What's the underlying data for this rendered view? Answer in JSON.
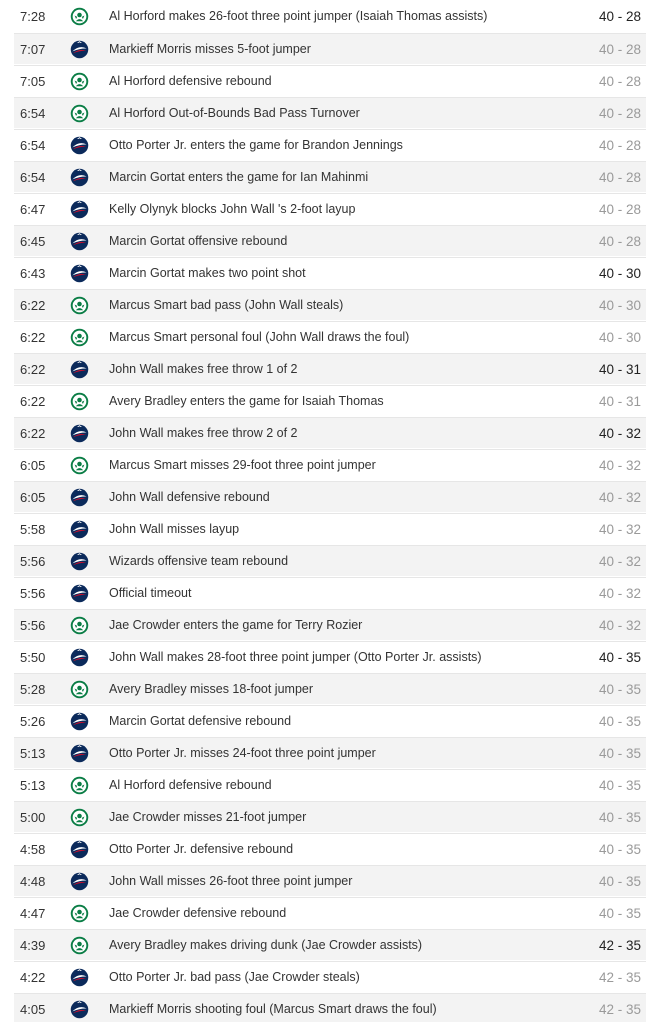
{
  "colors": {
    "celtics_green": "#0a7d45",
    "wizards_navy": "#0b2a5b",
    "wizards_red": "#c8102e",
    "score_unchanged": "#9a9a9a",
    "score_changed": "#222222"
  },
  "plays": [
    {
      "time": "7:28",
      "team": "BOS",
      "description": "Al Horford makes 26-foot three point jumper (Isaiah Thomas assists)",
      "score": "40 - 28",
      "score_changed": true
    },
    {
      "time": "7:07",
      "team": "WSH",
      "description": "Markieff Morris misses 5-foot jumper",
      "score": "40 - 28",
      "score_changed": false
    },
    {
      "time": "7:05",
      "team": "BOS",
      "description": "Al Horford defensive rebound",
      "score": "40 - 28",
      "score_changed": false
    },
    {
      "time": "6:54",
      "team": "BOS",
      "description": "Al Horford Out-of-Bounds Bad Pass Turnover",
      "score": "40 - 28",
      "score_changed": false
    },
    {
      "time": "6:54",
      "team": "WSH",
      "description": "Otto Porter Jr. enters the game for Brandon Jennings",
      "score": "40 - 28",
      "score_changed": false
    },
    {
      "time": "6:54",
      "team": "WSH",
      "description": "Marcin Gortat enters the game for Ian Mahinmi",
      "score": "40 - 28",
      "score_changed": false
    },
    {
      "time": "6:47",
      "team": "WSH",
      "description": "Kelly Olynyk blocks John Wall 's 2-foot layup",
      "score": "40 - 28",
      "score_changed": false
    },
    {
      "time": "6:45",
      "team": "WSH",
      "description": "Marcin Gortat offensive rebound",
      "score": "40 - 28",
      "score_changed": false
    },
    {
      "time": "6:43",
      "team": "WSH",
      "description": "Marcin Gortat makes two point shot",
      "score": "40 - 30",
      "score_changed": true
    },
    {
      "time": "6:22",
      "team": "BOS",
      "description": "Marcus Smart bad pass (John Wall steals)",
      "score": "40 - 30",
      "score_changed": false
    },
    {
      "time": "6:22",
      "team": "BOS",
      "description": "Marcus Smart personal foul (John Wall draws the foul)",
      "score": "40 - 30",
      "score_changed": false
    },
    {
      "time": "6:22",
      "team": "WSH",
      "description": "John Wall makes free throw 1 of 2",
      "score": "40 - 31",
      "score_changed": true
    },
    {
      "time": "6:22",
      "team": "BOS",
      "description": "Avery Bradley enters the game for Isaiah Thomas",
      "score": "40 - 31",
      "score_changed": false
    },
    {
      "time": "6:22",
      "team": "WSH",
      "description": "John Wall makes free throw 2 of 2",
      "score": "40 - 32",
      "score_changed": true
    },
    {
      "time": "6:05",
      "team": "BOS",
      "description": "Marcus Smart misses 29-foot three point jumper",
      "score": "40 - 32",
      "score_changed": false
    },
    {
      "time": "6:05",
      "team": "WSH",
      "description": "John Wall defensive rebound",
      "score": "40 - 32",
      "score_changed": false
    },
    {
      "time": "5:58",
      "team": "WSH",
      "description": "John Wall misses layup",
      "score": "40 - 32",
      "score_changed": false
    },
    {
      "time": "5:56",
      "team": "WSH",
      "description": "Wizards offensive team rebound",
      "score": "40 - 32",
      "score_changed": false
    },
    {
      "time": "5:56",
      "team": "WSH",
      "description": "Official timeout",
      "score": "40 - 32",
      "score_changed": false
    },
    {
      "time": "5:56",
      "team": "BOS",
      "description": "Jae Crowder enters the game for Terry Rozier",
      "score": "40 - 32",
      "score_changed": false
    },
    {
      "time": "5:50",
      "team": "WSH",
      "description": "John Wall makes 28-foot three point jumper (Otto Porter Jr. assists)",
      "score": "40 - 35",
      "score_changed": true
    },
    {
      "time": "5:28",
      "team": "BOS",
      "description": "Avery Bradley misses 18-foot jumper",
      "score": "40 - 35",
      "score_changed": false
    },
    {
      "time": "5:26",
      "team": "WSH",
      "description": "Marcin Gortat defensive rebound",
      "score": "40 - 35",
      "score_changed": false
    },
    {
      "time": "5:13",
      "team": "WSH",
      "description": "Otto Porter Jr. misses 24-foot three point jumper",
      "score": "40 - 35",
      "score_changed": false
    },
    {
      "time": "5:13",
      "team": "BOS",
      "description": "Al Horford defensive rebound",
      "score": "40 - 35",
      "score_changed": false
    },
    {
      "time": "5:00",
      "team": "BOS",
      "description": "Jae Crowder misses 21-foot jumper",
      "score": "40 - 35",
      "score_changed": false
    },
    {
      "time": "4:58",
      "team": "WSH",
      "description": "Otto Porter Jr. defensive rebound",
      "score": "40 - 35",
      "score_changed": false
    },
    {
      "time": "4:48",
      "team": "WSH",
      "description": "John Wall misses 26-foot three point jumper",
      "score": "40 - 35",
      "score_changed": false
    },
    {
      "time": "4:47",
      "team": "BOS",
      "description": "Jae Crowder defensive rebound",
      "score": "40 - 35",
      "score_changed": false
    },
    {
      "time": "4:39",
      "team": "BOS",
      "description": "Avery Bradley makes driving dunk (Jae Crowder assists)",
      "score": "42 - 35",
      "score_changed": true
    },
    {
      "time": "4:22",
      "team": "WSH",
      "description": "Otto Porter Jr. bad pass (Jae Crowder steals)",
      "score": "42 - 35",
      "score_changed": false
    },
    {
      "time": "4:05",
      "team": "WSH",
      "description": "Markieff Morris shooting foul (Marcus Smart draws the foul)",
      "score": "42 - 35",
      "score_changed": false
    }
  ]
}
